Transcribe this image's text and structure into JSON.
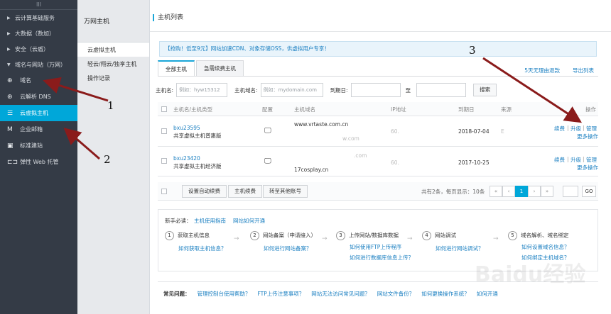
{
  "sidebar": {
    "handle": "III",
    "groups": [
      "云计算基础服务",
      "大数据（数加）",
      "安全（云盾）",
      "域名与网站（万网）"
    ],
    "items": [
      {
        "label": "域名",
        "icon": "globe-icon"
      },
      {
        "label": "云解析 DNS",
        "icon": "dns-icon"
      },
      {
        "label": "云虚拟主机",
        "icon": "server-icon"
      },
      {
        "label": "企业邮箱",
        "icon": "mail-icon"
      },
      {
        "label": "标准建站",
        "icon": "site-icon"
      },
      {
        "label": "弹性 Web 托管",
        "icon": "code-icon"
      }
    ]
  },
  "secondary": {
    "title": "万网主机",
    "items": [
      "云虚拟主机",
      "轻云/翔云/独享主机",
      "操作记录"
    ]
  },
  "page": {
    "title": "主机列表",
    "notice": "【抢购！低至9元】网站加速CDN、对象存储OSS，供虚拟用户专享！"
  },
  "tabs": [
    "全部主机",
    "急需续费主机"
  ],
  "top_links": [
    "5天无理由退款",
    "导出列表"
  ],
  "filter": {
    "host_label": "主机名:",
    "host_placeholder": "例如：hyw15312",
    "domain_label": "主机域名:",
    "domain_placeholder": "例如：mydomain.com",
    "date_label": "到期日:",
    "to": "至",
    "search": "搜索"
  },
  "table": {
    "headers": [
      "主机名/主机类型",
      "配置",
      "主机域名",
      "IP地址",
      "到期日",
      "来源",
      "操作"
    ],
    "rows": [
      {
        "name": "bxu23595",
        "type": "共享虚拟主机普惠版",
        "domain1": "www.vrtaste.com.cn",
        "domain2": "w.com",
        "ip": "60.",
        "date": "2018-07-04",
        "source": "E",
        "ops": [
          "续费",
          "升级",
          "管理"
        ],
        "more": "更多操作"
      },
      {
        "name": "bxu23420",
        "type": "共享虚拟主机经济版",
        "domain1": ".com",
        "domain2": "17cosplay.cn",
        "ip": "60.",
        "date": "2017-10-25",
        "source": "",
        "ops": [
          "续费",
          "升级",
          "管理"
        ],
        "more": "更多操作"
      }
    ]
  },
  "footer": {
    "buttons": [
      "设置自动续费",
      "主机续费",
      "转至其他账号"
    ],
    "summary": "共有2条，每页显示：10条",
    "page": "1",
    "go": "GO"
  },
  "guide": {
    "title": "新手必读：",
    "links": [
      "主机使用指南",
      "网站如何开通"
    ],
    "steps": [
      {
        "num": "1",
        "title": "获取主机信息",
        "link": "如何获取主机信息？"
      },
      {
        "num": "2",
        "title": "网站备案（申请接入）",
        "link": "如何进行网站备案？"
      },
      {
        "num": "3",
        "title": "上传网站/数据库数据",
        "link": "如何使用FTP上传程序",
        "link2": "如何进行数据库信息上传？"
      },
      {
        "num": "4",
        "title": "网站调试",
        "link": "如何进行网站调试？"
      },
      {
        "num": "5",
        "title": "域名解析、域名绑定",
        "link": "如何设置域名信息？",
        "link2": "如何绑定主机域名？"
      }
    ]
  },
  "faq": {
    "label": "常见问题：",
    "items": [
      "管理控制台使用帮助？",
      "FTP上传注意事项？",
      "网站无法访问常见问题？",
      "网站文件备份？",
      "如何更换操作系统？",
      "如何开通"
    ]
  },
  "annotations": [
    "1",
    "2",
    "3"
  ],
  "watermark": "Baidu经验",
  "colors": {
    "sidebar": "#343b46",
    "active": "#00a7d9",
    "link": "#1a7fc1",
    "pager_active": "#00a7d9"
  }
}
